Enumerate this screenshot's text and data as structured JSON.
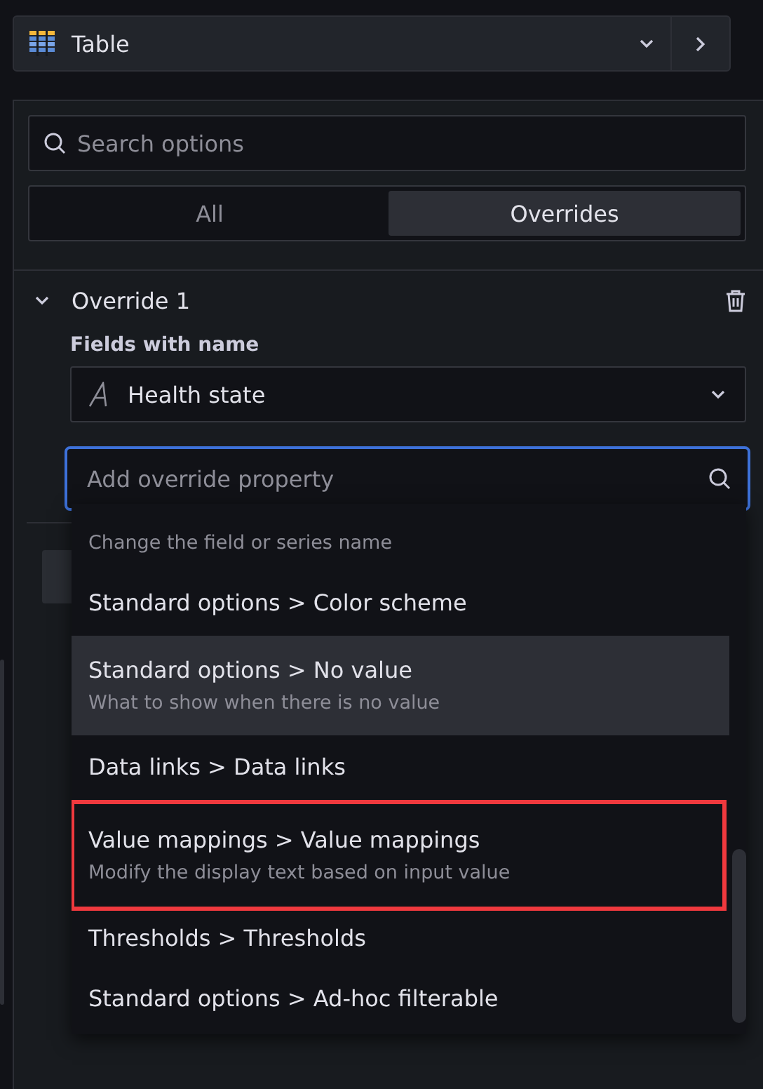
{
  "visualization_picker": {
    "label": "Table"
  },
  "search": {
    "placeholder": "Search options"
  },
  "tabs": [
    {
      "label": "All",
      "selected": false
    },
    {
      "label": "Overrides",
      "selected": true
    }
  ],
  "override": {
    "title": "Override 1",
    "expanded": true,
    "matcher_label": "Fields with name",
    "matcher_value": "Health state",
    "property_search": {
      "placeholder": "Add override property"
    },
    "options": [
      {
        "description": "Change the field or series name",
        "hovered": false,
        "highlighted": false
      },
      {
        "title": "Standard options > Color scheme",
        "hovered": false,
        "highlighted": false
      },
      {
        "title": "Standard options > No value",
        "description": "What to show when there is no value",
        "hovered": true,
        "highlighted": false
      },
      {
        "title": "Data links > Data links",
        "hovered": false,
        "highlighted": false
      },
      {
        "title": "Value mappings > Value mappings",
        "description": "Modify the display text based on input value",
        "hovered": false,
        "highlighted": true
      },
      {
        "title": "Thresholds > Thresholds",
        "hovered": false,
        "highlighted": false
      },
      {
        "title": "Standard options > Ad-hoc filterable",
        "hovered": false,
        "highlighted": false
      }
    ]
  }
}
